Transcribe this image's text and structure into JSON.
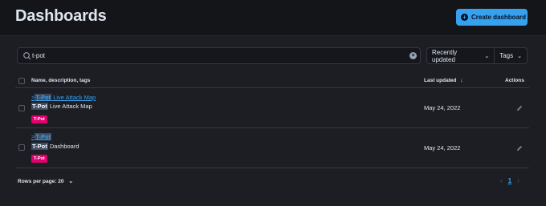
{
  "header": {
    "title": "Dashboards",
    "create_label": "Create dashboard"
  },
  "search": {
    "value": "t-pot"
  },
  "filters": {
    "sort_label": "Recently updated",
    "tags_label": "Tags"
  },
  "table": {
    "columns": {
      "name": "Name, description, tags",
      "updated": "Last updated",
      "actions": "Actions"
    },
    "rows": [
      {
        "title_prefix": ">",
        "title_highlight": "T-Pot",
        "title_rest": " Live Attack Map",
        "desc_highlight": "T-Pot",
        "desc_rest": " Live Attack Map",
        "tag": "T-Pot",
        "updated": "May 24, 2022"
      },
      {
        "title_prefix": ">",
        "title_highlight": "T-Pot",
        "title_rest": "",
        "desc_highlight": "T-Pot",
        "desc_rest": " Dashboard",
        "tag": "T-Pot",
        "updated": "May 24, 2022"
      }
    ]
  },
  "pagination": {
    "rows_per_page": "Rows per page: 20",
    "current_page": "1"
  },
  "icons": {
    "search": "search-icon",
    "clear": "clear-icon",
    "plus": "plus-icon",
    "sort": "arrow-down-icon",
    "edit": "pencil-icon",
    "chevron": "chevron-down-icon"
  },
  "colors": {
    "accent": "#36a2ef",
    "tag": "#e0006e",
    "highlight": "#3c4a63"
  }
}
